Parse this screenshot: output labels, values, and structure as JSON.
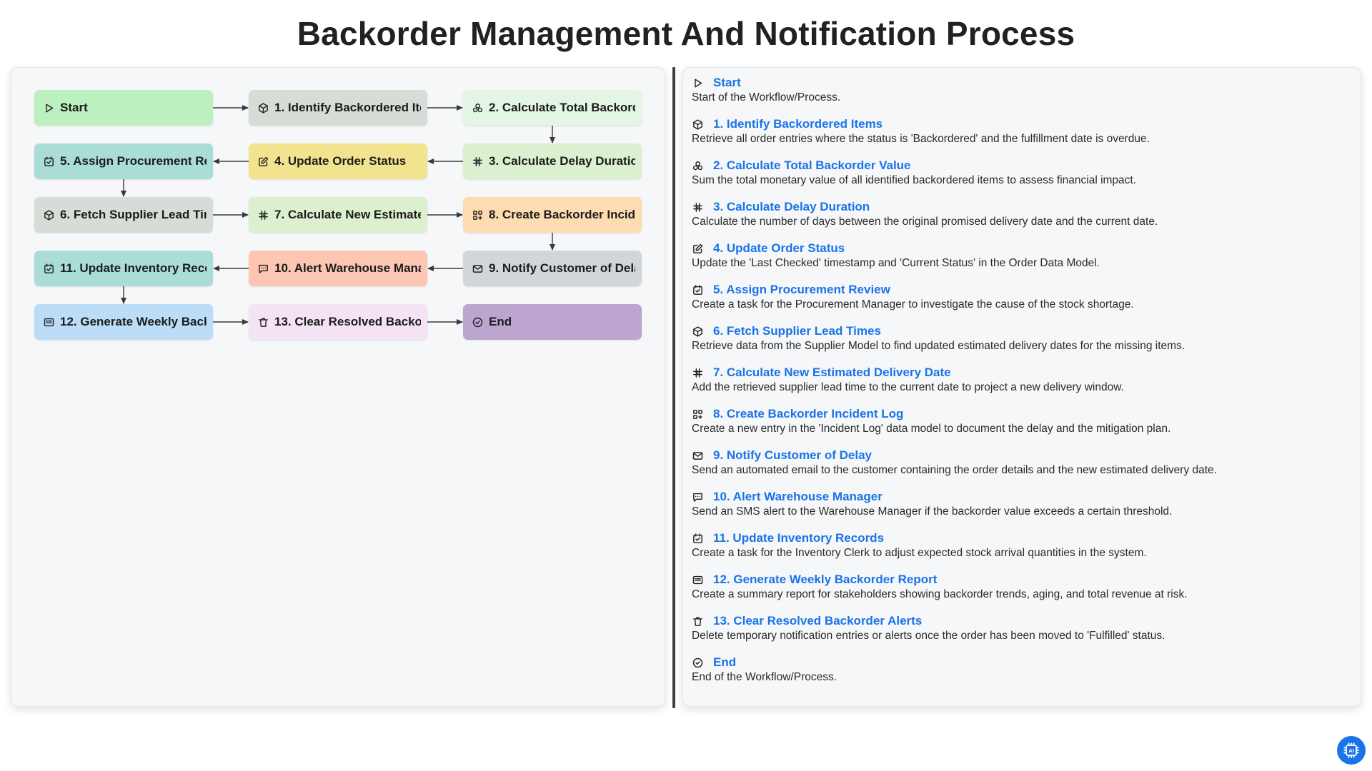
{
  "title": "Backorder Management And Notification Process",
  "colors": {
    "accent": "#1a73e8",
    "start": "#bdf0bf",
    "step1": "#d6ddd6",
    "step2": "#e4f6e3",
    "step3": "#dcefcf",
    "step4": "#f2e48f",
    "step5": "#a9ddd6",
    "step6": "#d6ddd6",
    "step7": "#dcefcf",
    "step8": "#fddcb1",
    "step9": "#d2d6da",
    "step10": "#fcc6b3",
    "step11": "#a9ddd6",
    "step12": "#bcdcf8",
    "step13": "#f4e3f2",
    "end": "#bca6cf"
  },
  "nodes": [
    {
      "id": "start",
      "label": "Start",
      "icon": "play-icon",
      "color": "#bdf0bf"
    },
    {
      "id": "step1",
      "label": "1. Identify Backordered Items",
      "icon": "cube-icon",
      "color": "#d6ddd6"
    },
    {
      "id": "step2",
      "label": "2. Calculate Total Backorder Value",
      "icon": "coins-icon",
      "color": "#e4f6e3"
    },
    {
      "id": "step3",
      "label": "3. Calculate Delay Duration",
      "icon": "hash-icon",
      "color": "#dcefcf"
    },
    {
      "id": "step4",
      "label": "4. Update Order Status",
      "icon": "edit-icon",
      "color": "#f2e48f"
    },
    {
      "id": "step5",
      "label": "5. Assign Procurement Review",
      "icon": "calendar-check-icon",
      "color": "#a9ddd6"
    },
    {
      "id": "step6",
      "label": "6. Fetch Supplier Lead Times",
      "icon": "cube-icon",
      "color": "#d6ddd6"
    },
    {
      "id": "step7",
      "label": "7. Calculate New Estimated Delivery Date",
      "icon": "hash-icon",
      "color": "#dcefcf"
    },
    {
      "id": "step8",
      "label": "8. Create Backorder Incident Log",
      "icon": "grid-plus-icon",
      "color": "#fddcb1"
    },
    {
      "id": "step9",
      "label": "9. Notify Customer of Delay",
      "icon": "mail-icon",
      "color": "#d2d6da"
    },
    {
      "id": "step10",
      "label": "10. Alert Warehouse Manager",
      "icon": "sms-icon",
      "color": "#fcc6b3"
    },
    {
      "id": "step11",
      "label": "11. Update Inventory Records",
      "icon": "calendar-check-icon",
      "color": "#a9ddd6"
    },
    {
      "id": "step12",
      "label": "12. Generate Weekly Backorder Report",
      "icon": "report-icon",
      "color": "#bcdcf8"
    },
    {
      "id": "step13",
      "label": "13. Clear Resolved Backorder Alerts",
      "icon": "trash-icon",
      "color": "#f4e3f2"
    },
    {
      "id": "end",
      "label": "End",
      "icon": "check-circle-icon",
      "color": "#bca6cf"
    }
  ],
  "edges": [
    [
      "start",
      "step1"
    ],
    [
      "step1",
      "step2"
    ],
    [
      "step2",
      "step3"
    ],
    [
      "step3",
      "step4"
    ],
    [
      "step4",
      "step5"
    ],
    [
      "step5",
      "step6"
    ],
    [
      "step6",
      "step7"
    ],
    [
      "step7",
      "step8"
    ],
    [
      "step8",
      "step9"
    ],
    [
      "step9",
      "step10"
    ],
    [
      "step10",
      "step11"
    ],
    [
      "step11",
      "step12"
    ],
    [
      "step12",
      "step13"
    ],
    [
      "step13",
      "end"
    ]
  ],
  "details": [
    {
      "title": "Start",
      "icon": "play-icon",
      "desc": "Start of the Workflow/Process."
    },
    {
      "title": "1. Identify Backordered Items",
      "icon": "cube-icon",
      "desc": "Retrieve all order entries where the status is 'Backordered' and the fulfillment date is overdue."
    },
    {
      "title": "2. Calculate Total Backorder Value",
      "icon": "coins-icon",
      "desc": "Sum the total monetary value of all identified backordered items to assess financial impact."
    },
    {
      "title": "3. Calculate Delay Duration",
      "icon": "hash-icon",
      "desc": "Calculate the number of days between the original promised delivery date and the current date."
    },
    {
      "title": "4. Update Order Status",
      "icon": "edit-icon",
      "desc": "Update the 'Last Checked' timestamp and 'Current Status' in the Order Data Model."
    },
    {
      "title": "5. Assign Procurement Review",
      "icon": "calendar-check-icon",
      "desc": "Create a task for the Procurement Manager to investigate the cause of the stock shortage."
    },
    {
      "title": "6. Fetch Supplier Lead Times",
      "icon": "cube-icon",
      "desc": "Retrieve data from the Supplier Model to find updated estimated delivery dates for the missing items."
    },
    {
      "title": "7. Calculate New Estimated Delivery Date",
      "icon": "hash-icon",
      "desc": "Add the retrieved supplier lead time to the current date to project a new delivery window."
    },
    {
      "title": "8. Create Backorder Incident Log",
      "icon": "grid-plus-icon",
      "desc": "Create a new entry in the 'Incident Log' data model to document the delay and the mitigation plan."
    },
    {
      "title": "9. Notify Customer of Delay",
      "icon": "mail-icon",
      "desc": "Send an automated email to the customer containing the order details and the new estimated delivery date."
    },
    {
      "title": "10. Alert Warehouse Manager",
      "icon": "sms-icon",
      "desc": "Send an SMS alert to the Warehouse Manager if the backorder value exceeds a certain threshold."
    },
    {
      "title": "11. Update Inventory Records",
      "icon": "calendar-check-icon",
      "desc": "Create a task for the Inventory Clerk to adjust expected stock arrival quantities in the system."
    },
    {
      "title": "12. Generate Weekly Backorder Report",
      "icon": "report-icon",
      "desc": "Create a summary report for stakeholders showing backorder trends, aging, and total revenue at risk."
    },
    {
      "title": "13. Clear Resolved Backorder Alerts",
      "icon": "trash-icon",
      "desc": "Delete temporary notification entries or alerts once the order has been moved to 'Fulfilled' status."
    },
    {
      "title": "End",
      "icon": "check-circle-icon",
      "desc": "End of the Workflow/Process."
    }
  ],
  "badge": {
    "label": "AI",
    "icon": "ai-chip-icon"
  }
}
